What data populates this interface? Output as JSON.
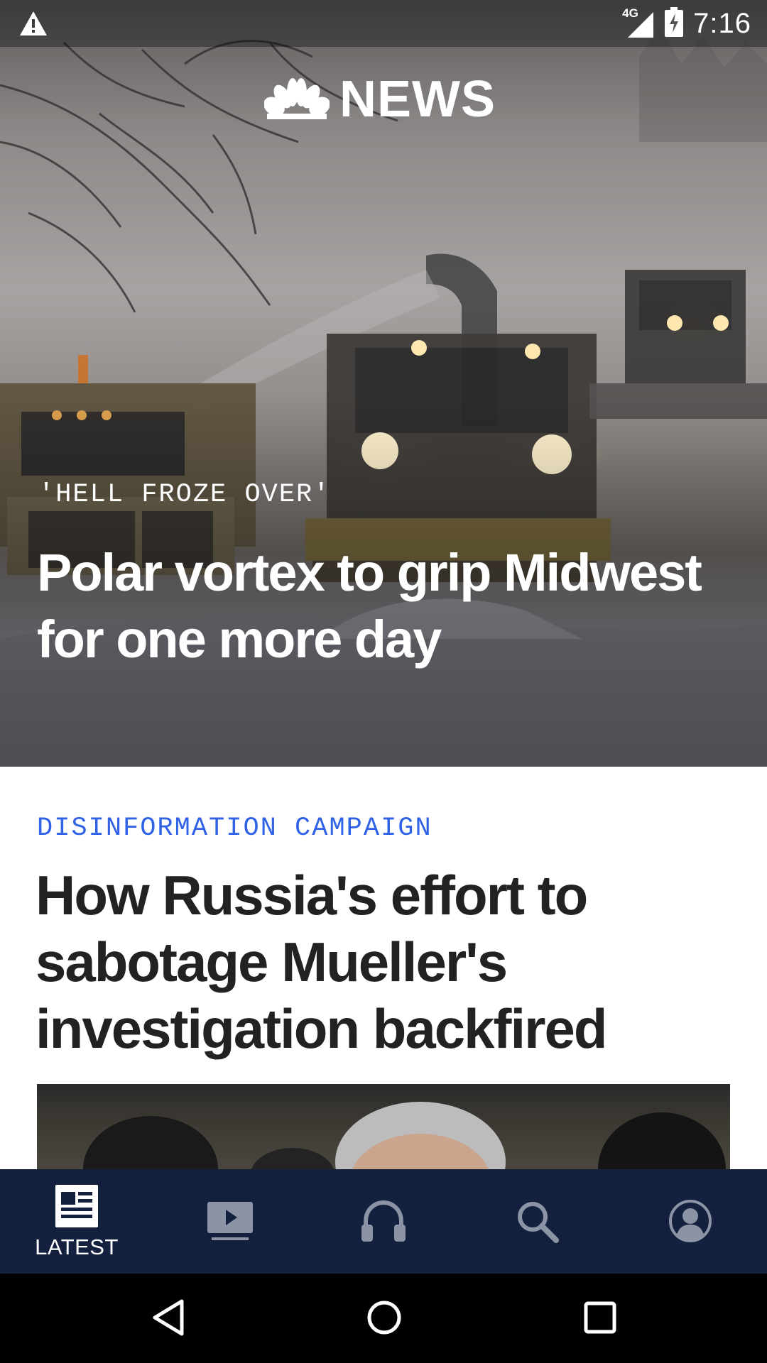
{
  "status_bar": {
    "time": "7:16",
    "network": "4G",
    "icons": [
      "warning-icon",
      "signal-icon",
      "battery-charging-icon"
    ]
  },
  "app": {
    "logo_text": "NEWS",
    "logo_icon": "peacock-logo"
  },
  "hero": {
    "kicker": "'HELL FROZE OVER'",
    "headline": "Polar vortex to grip Midwest for one more day"
  },
  "story": {
    "kicker": "DISINFORMATION CAMPAIGN",
    "headline": "How Russia's effort to sabotage Mueller's investigation backfired",
    "kicker_color": "#2f62e6"
  },
  "bottom_nav": {
    "items": [
      {
        "id": "latest",
        "label": "LATEST",
        "icon": "newspaper-icon",
        "active": true
      },
      {
        "id": "video",
        "label": "",
        "icon": "video-play-icon",
        "active": false
      },
      {
        "id": "audio",
        "label": "",
        "icon": "headphones-icon",
        "active": false
      },
      {
        "id": "search",
        "label": "",
        "icon": "search-icon",
        "active": false
      },
      {
        "id": "profile",
        "label": "",
        "icon": "profile-icon",
        "active": false
      }
    ],
    "background": "#13213f"
  },
  "system_nav": {
    "buttons": [
      "back-icon",
      "home-icon",
      "recents-icon"
    ]
  }
}
